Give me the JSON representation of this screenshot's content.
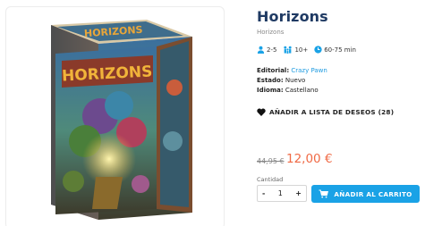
{
  "product": {
    "title": "Horizons",
    "subtitle": "Horizons",
    "box_title": "HORIZONS",
    "box_spine": "HORIZONS"
  },
  "specs": {
    "players": "2-5",
    "age": "10+",
    "duration": "60-75 min"
  },
  "details": {
    "publisher_label": "Editorial:",
    "publisher_value": "Crazy Pawn",
    "status_label": "Estado:",
    "status_value": "Nuevo",
    "language_label": "Idioma:",
    "language_value": "Castellano"
  },
  "wishlist": {
    "label": "AÑADIR A LISTA DE DESEOS (28)"
  },
  "price": {
    "old": "44,95 €",
    "new": "12,00 €"
  },
  "cart": {
    "qty_label": "Cantidad",
    "qty_minus": "-",
    "qty_value": "1",
    "qty_plus": "+",
    "add_label": "AÑADIR AL CARRITO"
  },
  "colors": {
    "title": "#1f3a63",
    "accent": "#1aa2e6",
    "price": "#f06a45"
  }
}
